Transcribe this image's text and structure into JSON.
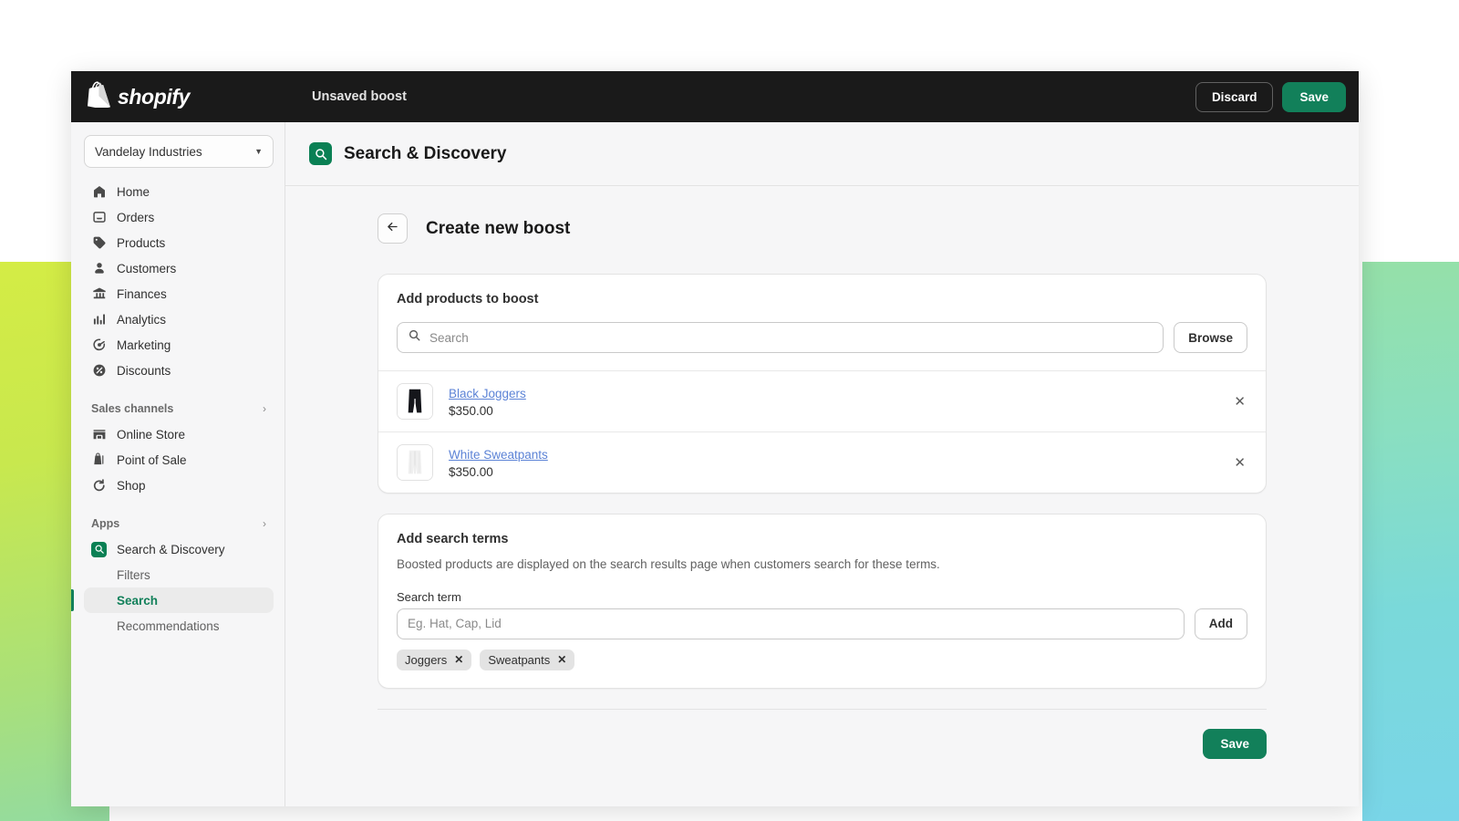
{
  "topbar": {
    "brand": "shopify",
    "title": "Unsaved boost",
    "discard_label": "Discard",
    "save_label": "Save"
  },
  "sidebar": {
    "store": "Vandelay Industries",
    "items": [
      {
        "label": "Home",
        "icon": "home-icon"
      },
      {
        "label": "Orders",
        "icon": "orders-icon"
      },
      {
        "label": "Products",
        "icon": "products-tag-icon"
      },
      {
        "label": "Customers",
        "icon": "customers-person-icon"
      },
      {
        "label": "Finances",
        "icon": "finances-bank-icon"
      },
      {
        "label": "Analytics",
        "icon": "analytics-bars-icon"
      },
      {
        "label": "Marketing",
        "icon": "marketing-target-icon"
      },
      {
        "label": "Discounts",
        "icon": "discounts-icon"
      }
    ],
    "sales_channels": {
      "label": "Sales channels",
      "items": [
        {
          "label": "Online Store",
          "icon": "online-store-icon"
        },
        {
          "label": "Point of Sale",
          "icon": "point-of-sale-icon"
        },
        {
          "label": "Shop",
          "icon": "shop-icon"
        }
      ]
    },
    "apps": {
      "label": "Apps",
      "app_name": "Search & Discovery",
      "sub_items": [
        {
          "label": "Filters",
          "selected": false
        },
        {
          "label": "Search",
          "selected": true
        },
        {
          "label": "Recommendations",
          "selected": false
        }
      ]
    }
  },
  "app_header": {
    "title": "Search & Discovery"
  },
  "page": {
    "title": "Create new boost",
    "back_label": "back-arrow"
  },
  "products_card": {
    "title": "Add products to boost",
    "search_placeholder": "Search",
    "search_value": "",
    "browse_label": "Browse",
    "items": [
      {
        "name": "Black Joggers",
        "price": "$350.00",
        "thumb": "black-joggers"
      },
      {
        "name": "White Sweatpants",
        "price": "$350.00",
        "thumb": "white-sweatpants"
      }
    ],
    "remove_label": "✕"
  },
  "terms_card": {
    "title": "Add search terms",
    "description": "Boosted products are displayed on the search results page when customers search for these terms.",
    "field_label": "Search term",
    "input_placeholder": "Eg. Hat, Cap, Lid",
    "input_value": "",
    "add_label": "Add",
    "tags": [
      {
        "label": "Joggers",
        "remove": "✕"
      },
      {
        "label": "Sweatpants",
        "remove": "✕"
      }
    ]
  },
  "footer": {
    "save_label": "Save"
  },
  "colors": {
    "brand_green": "#12805a",
    "app_icon_green": "#0a8054",
    "topbar_dark": "#1a1a1a",
    "link_blue": "#5c83d6"
  }
}
